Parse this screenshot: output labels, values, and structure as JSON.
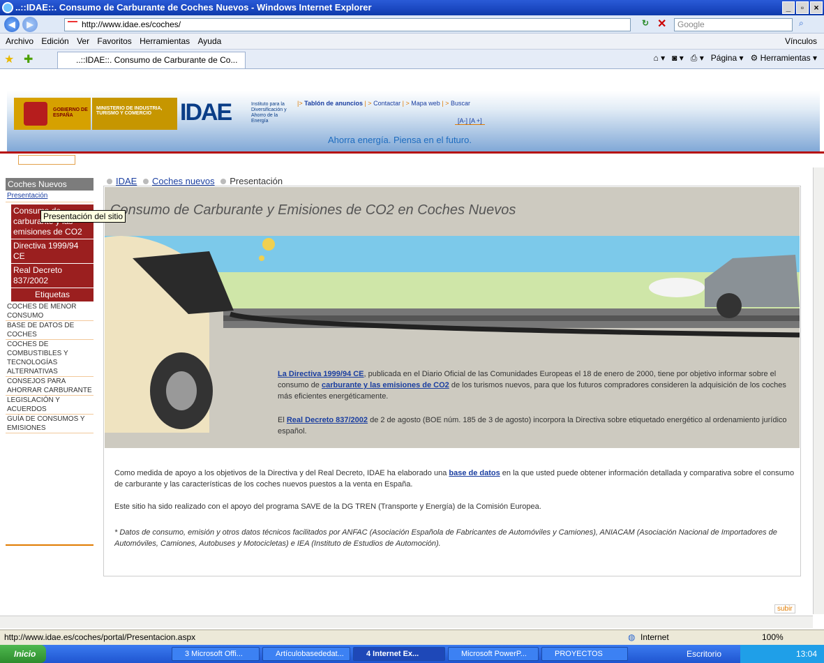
{
  "window": {
    "title": "..::IDAE::. Consumo de Carburante de Coches Nuevos - Windows Internet Explorer"
  },
  "address": {
    "url": "http://www.idae.es/coches/",
    "search_placeholder": "Google"
  },
  "menu": [
    "Archivo",
    "Edición",
    "Ver",
    "Favoritos",
    "Herramientas",
    "Ayuda"
  ],
  "menu_links": "Vínculos",
  "tab": {
    "label": "..::IDAE::. Consumo de Carburante de Co..."
  },
  "toolbar": {
    "page": "Página",
    "tools": "Herramientas"
  },
  "header": {
    "gobierno": "GOBIERNO DE ESPAÑA",
    "ministerio": "MINISTERIO DE INDUSTRIA, TURISMO Y COMERCIO",
    "idae_logo": "IDAE",
    "idae_sub": "Instituto para la Diversificación y Ahorro de la Energía",
    "links": [
      "Tablón de anuncios",
      "Contactar",
      "Mapa web",
      "Buscar"
    ],
    "font_size": "[A-]  [A +]",
    "slogan": "Ahorra energía. Piensa en el futuro."
  },
  "sidebar": {
    "header": "Coches Nuevos",
    "active": "Presentación",
    "subitems": [
      "Consumo de carburante y las emisiones de CO2",
      "Directiva 1999/94 CE",
      "Real Decreto 837/2002",
      "Etiquetas"
    ],
    "items": [
      "Coches de menor consumo",
      "Base de datos de coches",
      "Coches de combustibles y tecnologías alternativas",
      "Consejos para ahorrar carburante",
      "Legislación y acuerdos",
      "Guía de consumos y emisiones"
    ]
  },
  "tooltip": "Presentación del sitio",
  "breadcrumb": [
    "IDAE",
    "Coches nuevos",
    "Presentación"
  ],
  "main": {
    "title": "Consumo de Carburante y Emisiones de CO2 en Coches Nuevos",
    "p1_link": "La Directiva 1999/94 CE",
    "p1_a": ", publicada en el Diario Oficial de las Comunidades Europeas el 18 de enero de 2000, tiene por objetivo informar sobre el consumo de ",
    "p1_link2": "carburante y las emisiones de CO2",
    "p1_b": " de los turismos nuevos, para que los futuros compradores consideren la adquisición de los coches más eficientes energéticamente.",
    "p2_a": "El ",
    "p2_link": "Real Decreto 837/2002",
    "p2_b": " de 2 de agosto (BOE núm. 185 de 3 de agosto) incorpora la Directiva sobre etiquetado energético al ordenamiento jurídico español.",
    "p3_a": "Como medida de apoyo a los objetivos de la Directiva y del Real Decreto, IDAE ha elaborado una ",
    "p3_link": "base de datos",
    "p3_b": " en la que usted puede obtener información detallada y comparativa sobre el consumo de carburante y las características de los coches nuevos puestos a la venta en España.",
    "p4": "Este sitio ha sido realizado con el apoyo del programa SAVE de la DG TREN (Transporte y Energía) de la Comisión Europea.",
    "p5": "* Datos de consumo, emisión y otros datos técnicos facilitados por ANFAC (Asociación Española de Fabricantes de Automóviles y Camiones), ANIACAM (Asociación Nacional de Importadores de Automóviles, Camiones, Autobuses y Motocicletas) e IEA (Instituto de Estudios de Automoción)."
  },
  "subir": "subir",
  "status": {
    "url": "http://www.idae.es/coches/portal/Presentacion.aspx",
    "zone": "Internet",
    "zoom": "100%"
  },
  "taskbar": {
    "start": "Inicio",
    "items": [
      "3 Microsoft Offi...",
      "Artículobasededat...",
      "4 Internet Ex...",
      "Microsoft PowerP...",
      "PROYECTOS"
    ],
    "desktop": "Escritorio",
    "clock": "13:04"
  }
}
